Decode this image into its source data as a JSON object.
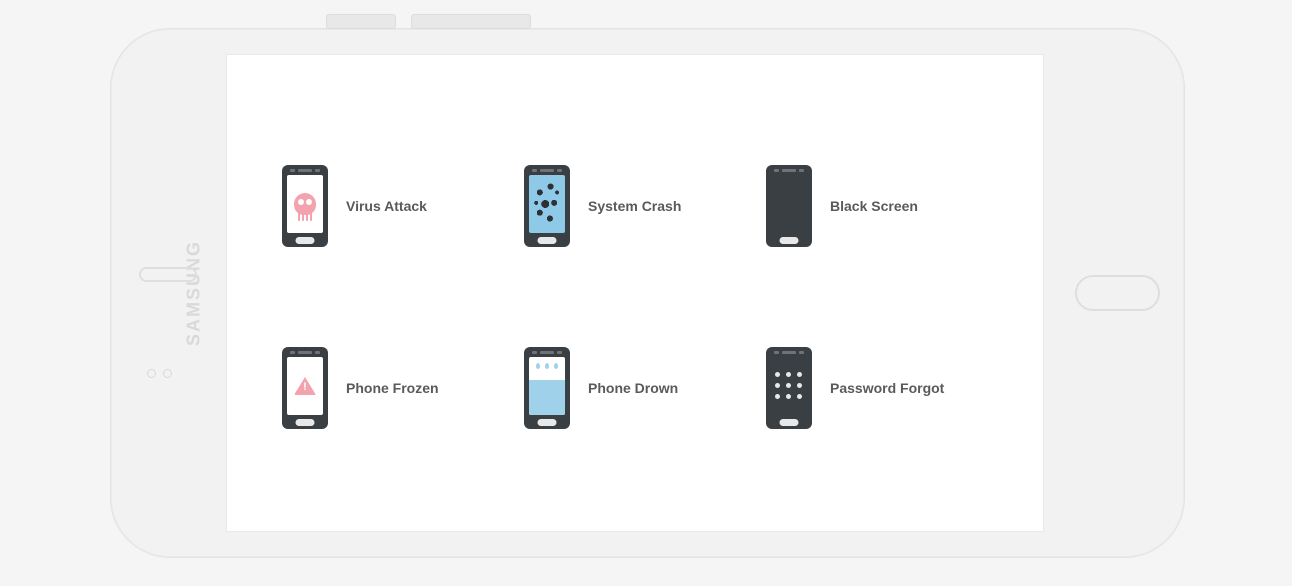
{
  "device": {
    "brand": "SAMSUNG"
  },
  "items": [
    {
      "id": "virus",
      "label": "Virus Attack"
    },
    {
      "id": "crash",
      "label": "System Crash"
    },
    {
      "id": "black",
      "label": "Black Screen"
    },
    {
      "id": "frozen",
      "label": "Phone Frozen"
    },
    {
      "id": "drown",
      "label": "Phone Drown"
    },
    {
      "id": "pass",
      "label": "Password Forgot"
    }
  ]
}
